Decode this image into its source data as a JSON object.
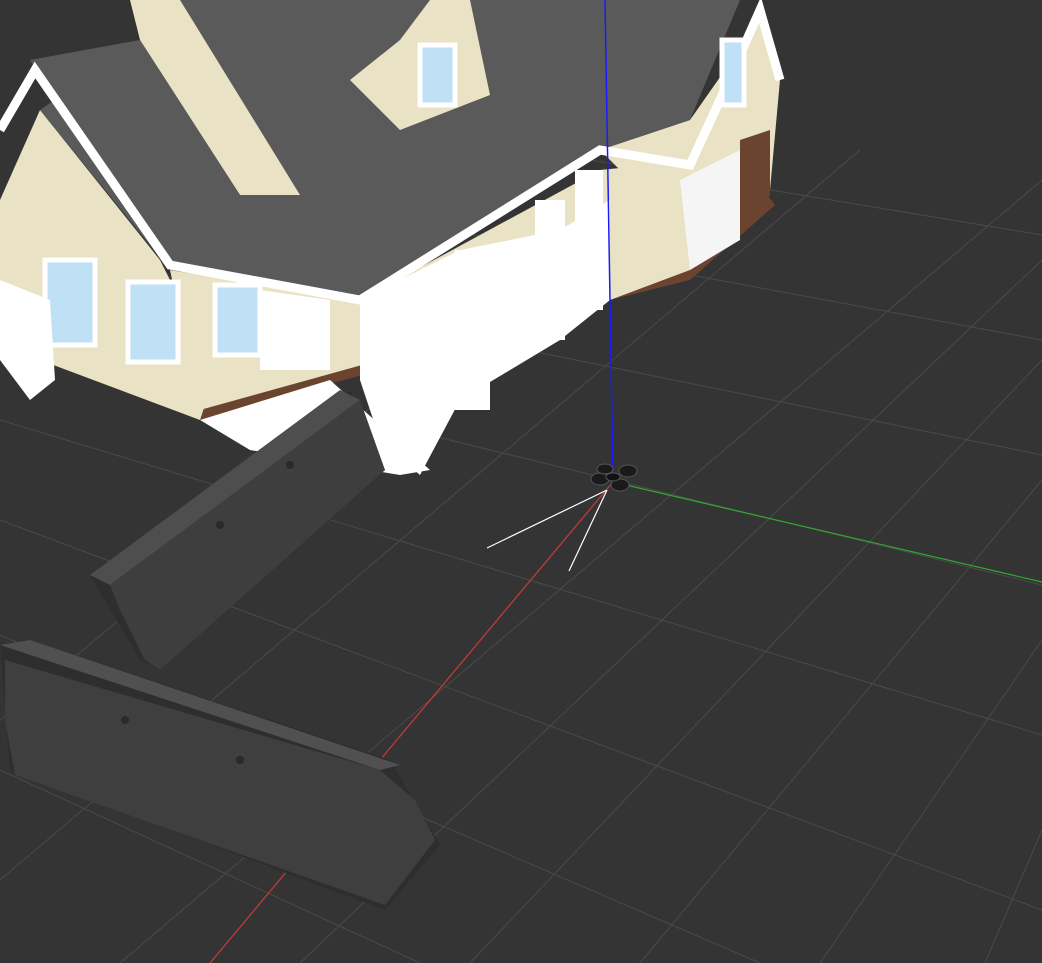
{
  "app": {
    "window": "3d-simulation-viewport",
    "background_color": "#343434"
  },
  "scene": {
    "ground": {
      "grid_color": "#4a4a4a",
      "background_color": "#343434"
    },
    "axes": {
      "x_axis_color": "#c83a3a",
      "y_axis_color": "#2faa2f",
      "z_axis_color": "#1a1aff"
    },
    "objects": [
      {
        "name": "house",
        "colors": {
          "roof": "#5a5a5a",
          "siding": "#e9e2c4",
          "trim": "#ffffff",
          "foundation": "#6b4430"
        }
      },
      {
        "name": "concrete-barrier",
        "count": 2,
        "color": "#3e3e3e"
      },
      {
        "name": "quadcopter-drone",
        "color": "#1a1a1a"
      },
      {
        "name": "sensor-rays",
        "count": 2,
        "color": "#ffffff"
      }
    ]
  }
}
